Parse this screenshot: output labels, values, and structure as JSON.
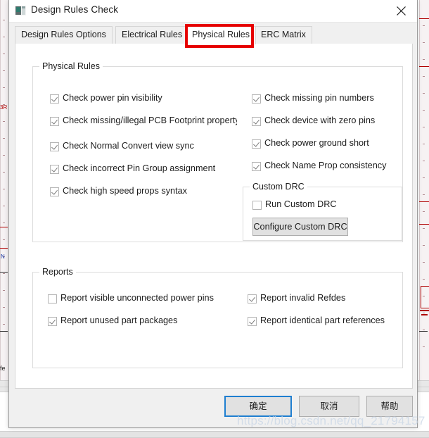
{
  "window": {
    "title": "Design Rules Check",
    "icon": "app-icon",
    "close_label": "×"
  },
  "tabs": [
    {
      "label": "Design Rules Options",
      "active": false
    },
    {
      "label": "Electrical Rules",
      "active": false
    },
    {
      "label": "Physical Rules",
      "active": true
    },
    {
      "label": "ERC Matrix",
      "active": false
    }
  ],
  "annotation": {
    "color": "#e60000",
    "target": "Physical Rules"
  },
  "physical_rules": {
    "legend": "Physical Rules",
    "left_column": [
      {
        "label": "Check power pin visibility",
        "checked": true
      },
      {
        "label": "Check missing/illegal PCB Footprint property",
        "checked": true
      },
      {
        "label": "Check Normal Convert view sync",
        "checked": true
      },
      {
        "label": "Check incorrect Pin Group assignment",
        "checked": true
      },
      {
        "label": "Check high speed props syntax",
        "checked": true
      }
    ],
    "right_column": [
      {
        "label": "Check missing pin numbers",
        "checked": true
      },
      {
        "label": "Check device with zero pins",
        "checked": true
      },
      {
        "label": "Check power ground short",
        "checked": true
      },
      {
        "label": "Check Name Prop consistency",
        "checked": true
      }
    ]
  },
  "custom_drc": {
    "legend": "Custom DRC",
    "run_label": "Run Custom DRC",
    "run_checked": false,
    "configure_label": "Configure Custom DRC"
  },
  "reports": {
    "legend": "Reports",
    "left_column": [
      {
        "label": "Report visible unconnected power pins",
        "checked": false
      },
      {
        "label": "Report unused part packages",
        "checked": true
      }
    ],
    "right_column": [
      {
        "label": "Report invalid Refdes",
        "checked": true
      },
      {
        "label": "Report identical part references",
        "checked": true
      }
    ]
  },
  "footer": {
    "ok": "确定",
    "cancel": "取消",
    "help": "帮助"
  },
  "watermark": "https://blog.csdn.net/qq_21794157",
  "background": {
    "label_n": "N",
    "label_fe": "fe",
    "label_ref": "3R"
  }
}
